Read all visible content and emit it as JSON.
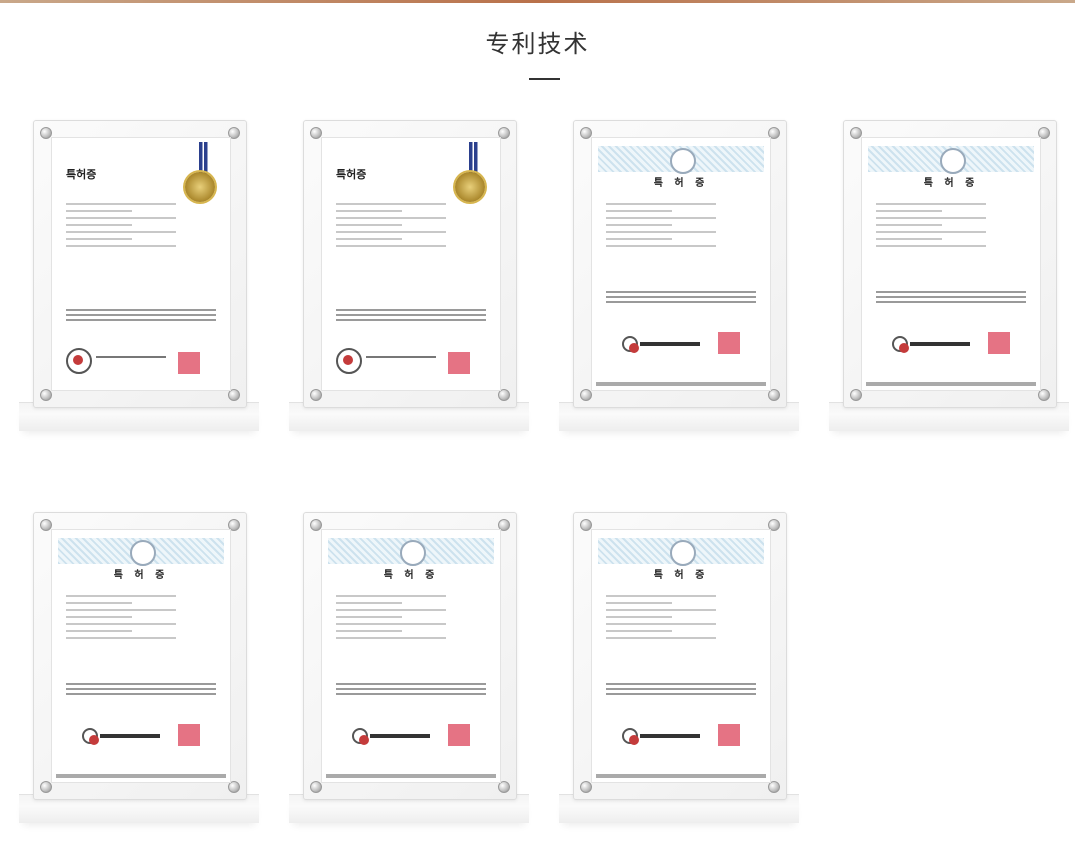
{
  "page": {
    "title": "专利技术"
  },
  "certificates": [
    {
      "doc_title": "특허증",
      "doc_style": "ribbon"
    },
    {
      "doc_title": "특허증",
      "doc_style": "ribbon"
    },
    {
      "doc_title": "특 허 증",
      "doc_style": "korean"
    },
    {
      "doc_title": "특 허 증",
      "doc_style": "korean"
    },
    {
      "doc_title": "특 허 증",
      "doc_style": "korean"
    },
    {
      "doc_title": "특 허 증",
      "doc_style": "korean"
    },
    {
      "doc_title": "특 허 증",
      "doc_style": "korean"
    }
  ],
  "colors": {
    "accent_bar": "#b9714a",
    "title_text": "#333333",
    "stamp": "#e15a6e",
    "ribbon": "#2b3f8d",
    "seal_gold": "#a9862a"
  }
}
